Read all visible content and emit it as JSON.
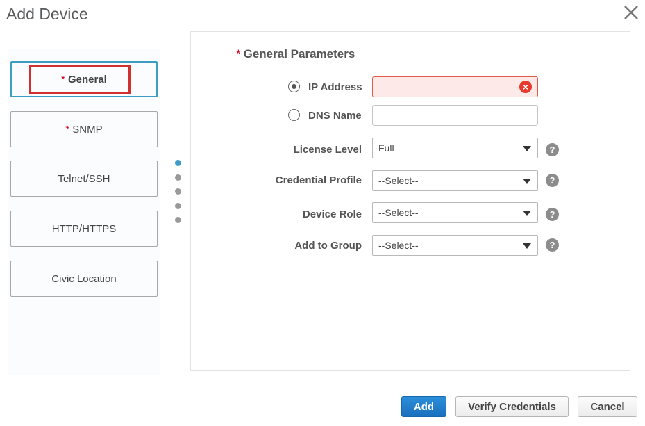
{
  "dialog": {
    "title": "Add Device",
    "close_icon": "close-icon"
  },
  "sidebar": {
    "items": [
      {
        "label": "General",
        "required": "*",
        "active": true
      },
      {
        "label": "SNMP",
        "required": "*",
        "active": false
      },
      {
        "label": "Telnet/SSH",
        "required": "",
        "active": false
      },
      {
        "label": "HTTP/HTTPS",
        "required": "",
        "active": false
      },
      {
        "label": "Civic Location",
        "required": "",
        "active": false
      }
    ]
  },
  "pager": {
    "count": 5,
    "active_index": 0
  },
  "form": {
    "section_title": "General Parameters",
    "required_mark": "*",
    "ip_address": {
      "label": "IP Address",
      "value": "",
      "selected": true,
      "error_icon": "error-circle-icon"
    },
    "dns_name": {
      "label": "DNS Name",
      "value": "",
      "selected": false
    },
    "license_level": {
      "label": "License Level",
      "value": "Full"
    },
    "credential_profile": {
      "label": "Credential Profile",
      "value": "--Select--"
    },
    "device_role": {
      "label": "Device Role",
      "value": "--Select--"
    },
    "add_to_group": {
      "label": "Add to Group",
      "value": "--Select--"
    },
    "help_glyph": "?"
  },
  "footer": {
    "add_label": "Add",
    "verify_label": "Verify Credentials",
    "cancel_label": "Cancel"
  },
  "colors": {
    "accent": "#3c9cc2",
    "primary_button": "#1a70bf",
    "required": "#d0021b",
    "error": "#e8392c",
    "highlight_box": "#d0312d"
  }
}
